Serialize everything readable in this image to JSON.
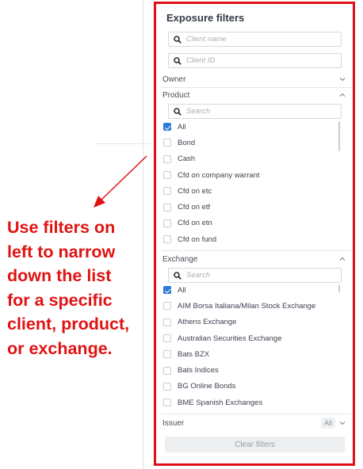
{
  "callout": {
    "lines": [
      "Use filters on",
      "left to narrow",
      "down the list",
      "for a specific",
      "client, product,",
      "or exchange."
    ],
    "color": "#e01212"
  },
  "panel": {
    "title": "Exposure filters",
    "border_color": "#e0101a",
    "client_name": {
      "placeholder": "Client name"
    },
    "client_id": {
      "placeholder": "Client ID"
    },
    "owner": {
      "label": "Owner",
      "state": "collapsed"
    },
    "product": {
      "label": "Product",
      "state": "expanded",
      "search_placeholder": "Search",
      "options": [
        {
          "label": "All",
          "checked": true
        },
        {
          "label": "Bond",
          "checked": false
        },
        {
          "label": "Cash",
          "checked": false
        },
        {
          "label": "Cfd on company warrant",
          "checked": false
        },
        {
          "label": "Cfd on etc",
          "checked": false
        },
        {
          "label": "Cfd on etf",
          "checked": false
        },
        {
          "label": "Cfd on etn",
          "checked": false
        },
        {
          "label": "Cfd on fund",
          "checked": false
        }
      ]
    },
    "exchange": {
      "label": "Exchange",
      "state": "expanded",
      "search_placeholder": "Search",
      "options": [
        {
          "label": "All",
          "checked": true
        },
        {
          "label": "AIM Borsa Italiana/Milan Stock Exchange",
          "checked": false
        },
        {
          "label": "Athens Exchange",
          "checked": false
        },
        {
          "label": "Australian Securities Exchange",
          "checked": false
        },
        {
          "label": "Bats BZX",
          "checked": false
        },
        {
          "label": "Bats Indices",
          "checked": false
        },
        {
          "label": "BG Online Bonds",
          "checked": false
        },
        {
          "label": "BME Spanish Exchanges",
          "checked": false
        }
      ]
    },
    "issuer": {
      "label": "Issuer",
      "value": "All"
    },
    "clear_button": "Clear filters"
  }
}
